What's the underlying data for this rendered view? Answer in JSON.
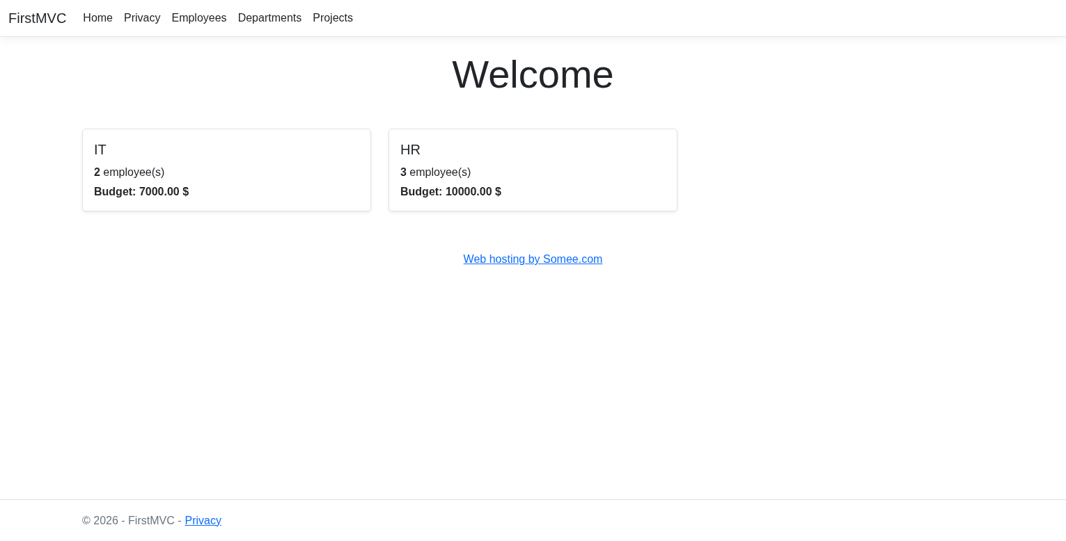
{
  "navbar": {
    "brand": "FirstMVC",
    "links": [
      "Home",
      "Privacy",
      "Employees",
      "Departments",
      "Projects"
    ]
  },
  "heading": "Welcome",
  "departments": [
    {
      "name": "IT",
      "employees": "**2** employee(s)",
      "budget": "Budget: 7000.00 $"
    },
    {
      "name": "HR",
      "employees": "**3** employee(s)",
      "budget": "Budget: 10000.00 $"
    }
  ],
  "hosting_link": "Web hosting by Somee.com",
  "footer": {
    "text": "© 2026 - FirstMVC -",
    "link": "Privacy"
  }
}
